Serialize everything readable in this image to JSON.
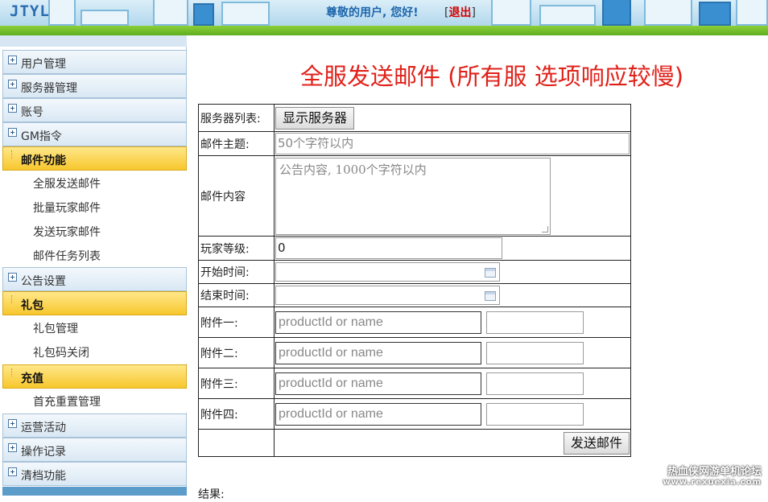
{
  "header": {
    "logo": "JTYL",
    "greeting": "尊敬的用户, 您好!",
    "logout_open": "[",
    "logout_label": "退出",
    "logout_close": "]"
  },
  "sidebar": {
    "groups": [
      {
        "label": "用户管理",
        "open": false
      },
      {
        "label": "服务器管理",
        "open": false
      },
      {
        "label": "账号",
        "open": false
      },
      {
        "label": "GM指令",
        "open": false
      },
      {
        "label": "邮件功能",
        "open": true,
        "items": [
          "全服发送邮件",
          "批量玩家邮件",
          "发送玩家邮件",
          "邮件任务列表"
        ]
      },
      {
        "label": "公告设置",
        "open": false
      },
      {
        "label": "礼包",
        "open": true,
        "items": [
          "礼包管理",
          "礼包码关闭"
        ]
      },
      {
        "label": "充值",
        "open": true,
        "items": [
          "首充重置管理"
        ]
      },
      {
        "label": "运营活动",
        "open": false
      },
      {
        "label": "操作记录",
        "open": false
      },
      {
        "label": "清档功能",
        "open": false
      }
    ]
  },
  "main": {
    "title": "全服发送邮件 (所有服 选项响应较慢)",
    "form": {
      "server_list_label": "服务器列表:",
      "show_servers_button": "显示服务器",
      "subject_label": "邮件主题:",
      "subject_placeholder": "50个字符以内",
      "content_label": "邮件内容",
      "content_placeholder": "公告内容, 1000个字符以内",
      "level_label": "玩家等级:",
      "level_value": "0",
      "start_label": "开始时间:",
      "end_label": "结束时间:",
      "attachments": [
        {
          "label": "附件一:",
          "placeholder": "productId or name"
        },
        {
          "label": "附件二:",
          "placeholder": "productId or name"
        },
        {
          "label": "附件三:",
          "placeholder": "productId or name"
        },
        {
          "label": "附件四:",
          "placeholder": "productId or name"
        }
      ],
      "send_button": "发送邮件"
    },
    "result_label": "结果:"
  },
  "watermark": {
    "line1": "热血侠网游单机论坛",
    "line2": "www.rexuexia.com"
  },
  "colors": {
    "title_red": "#e0211a",
    "open_menu_yellow": "#f7c72d",
    "header_blue": "#1e66ad",
    "header_green": "#5fae1f"
  }
}
